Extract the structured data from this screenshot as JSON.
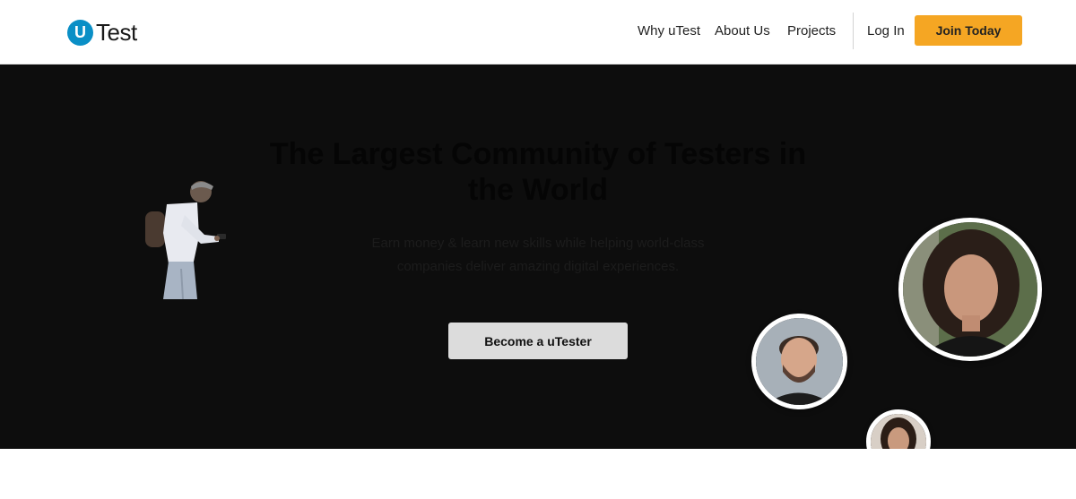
{
  "header": {
    "logo_mark": "U",
    "logo_text": "Test",
    "nav": {
      "why": "Why uTest",
      "about": "About Us",
      "projects": "Projects",
      "login": "Log In",
      "join": "Join Today"
    }
  },
  "hero": {
    "title": "The Largest Community of Testers in the World",
    "subtitle": "Earn money & learn new skills while helping world-class companies deliver amazing digital experiences.",
    "cta": "Become a uTester"
  },
  "colors": {
    "brand_blue": "#0a8fc6",
    "accent_orange": "#f5a623",
    "hero_background": "#0d0d0d",
    "cta_background": "#dcdcdc"
  },
  "icons": [
    "logo-mark-icon",
    "person-illustration",
    "avatar-photo"
  ]
}
